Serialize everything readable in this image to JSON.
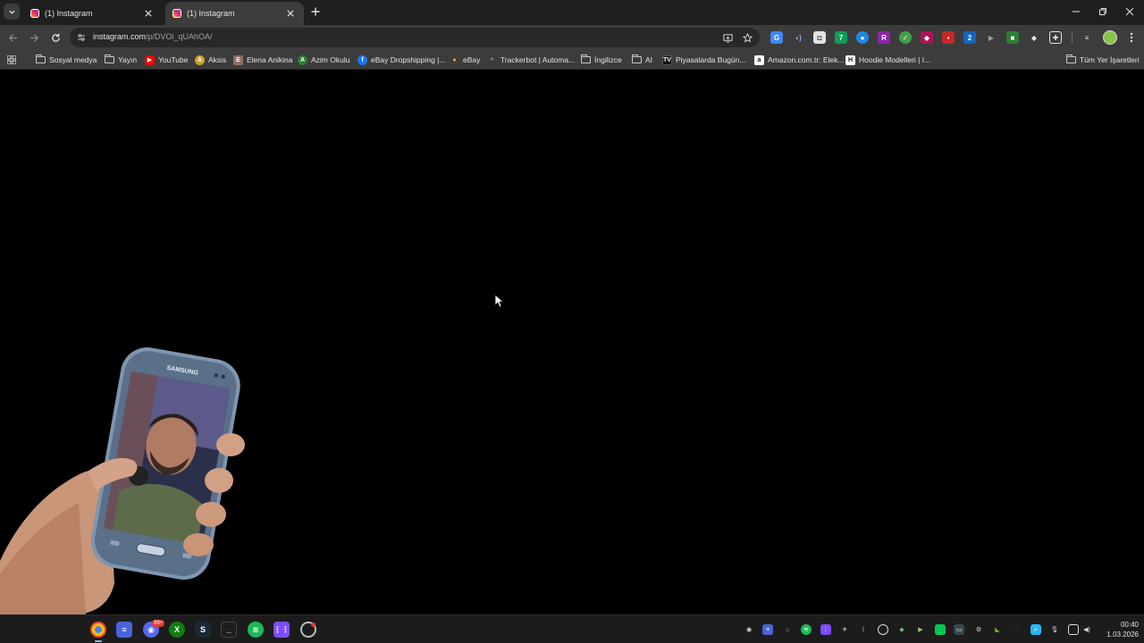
{
  "tabs": [
    {
      "title": "(1) Instagram",
      "active": false
    },
    {
      "title": "(1) Instagram",
      "active": true
    }
  ],
  "icons": {
    "tab_search": "chevron-down-icon",
    "new_tab": "plus-icon",
    "close": "close-icon",
    "minimize": "minimize-icon",
    "restore": "restore-icon",
    "back": "arrow-left-icon",
    "forward": "arrow-right-icon",
    "reload": "reload-icon",
    "bookmark": "star-icon",
    "menu": "more-vertical-icon"
  },
  "address_bar": {
    "host": "instagram.com",
    "path": "/p/DVOi_qUAhOA/"
  },
  "bookmarks": [
    {
      "label": "Sosyal medya",
      "type": "folder"
    },
    {
      "label": "Yayın",
      "type": "folder"
    },
    {
      "label": "YouTube",
      "type": "link",
      "color": "#ff0000"
    },
    {
      "label": "Aksis",
      "type": "link",
      "color": "#c9a227"
    },
    {
      "label": "Elena Anikina",
      "type": "link",
      "color": "#8d6e63"
    },
    {
      "label": "Azim Okulu",
      "type": "link",
      "color": "#2e7d32"
    },
    {
      "label": "eBay Dropshipping |...",
      "type": "link",
      "color": "#1877f2"
    },
    {
      "label": "eBay",
      "type": "link",
      "color": "#f5af02"
    },
    {
      "label": "Trackerbot | Automa...",
      "type": "link",
      "color": "#546e7a"
    },
    {
      "label": "İngilizce",
      "type": "folder"
    },
    {
      "label": "AI",
      "type": "folder"
    },
    {
      "label": "Piyasalarda Bugün...",
      "type": "link",
      "color": "#111111"
    },
    {
      "label": "Amazon.com.tr: Elek...",
      "type": "link",
      "color": "#ffffff"
    },
    {
      "label": "Hoodie Modelleri | I...",
      "type": "link",
      "color": "#ffffff"
    }
  ],
  "all_bookmarks_label": "Tüm Yer İşaretleri",
  "overlay_label": "SAMSUNG",
  "clock": {
    "time": "00:40",
    "date": "1.03.2026"
  },
  "taskbar_badge": "99+",
  "colors": {
    "browser_frame": "#1f1f1f",
    "toolbar": "#3c3c3c",
    "omnibox": "#282828",
    "page_background": "#000000",
    "taskbar": "#1c1c1c"
  }
}
